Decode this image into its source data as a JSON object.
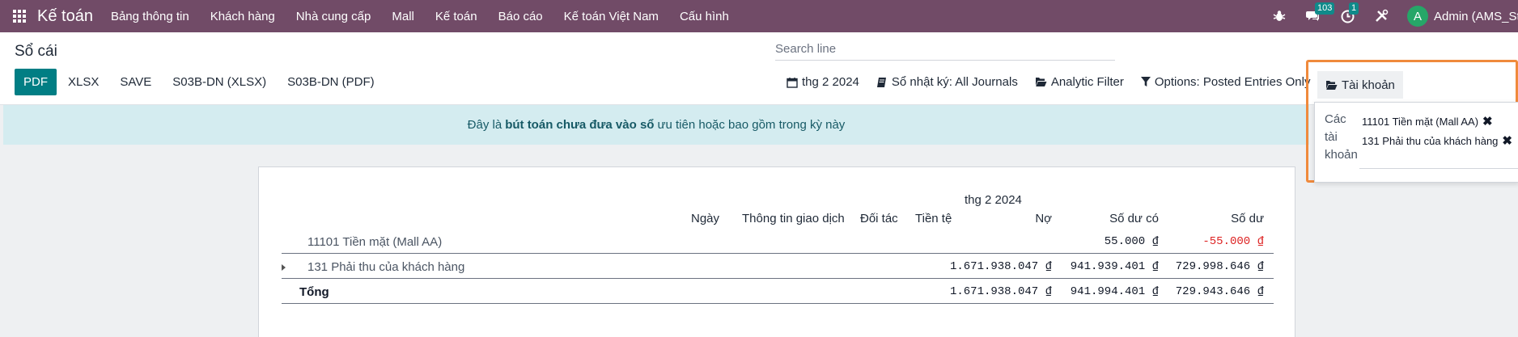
{
  "navbar": {
    "app_name": "Kế toán",
    "menu": [
      "Bảng thông tin",
      "Khách hàng",
      "Nhà cung cấp",
      "Mall",
      "Kế toán",
      "Báo cáo",
      "Kế toán Việt Nam",
      "Cấu hình"
    ],
    "messages_count": "103",
    "activity_count": "1",
    "avatar_letter": "A",
    "user_name": "Admin (AMS_Sta"
  },
  "control": {
    "title": "Sổ cái",
    "search_placeholder": "Search line",
    "buttons": {
      "pdf": "PDF",
      "xlsx": "XLSX",
      "save": "SAVE",
      "s03b_xlsx": "S03B-DN (XLSX)",
      "s03b_pdf": "S03B-DN (PDF)"
    },
    "filters": {
      "date": "thg 2 2024",
      "journal": "Sổ nhật ký: All Journals",
      "analytic": "Analytic Filter",
      "options": "Options: Posted Entries Only",
      "accounts": "Tài khoản"
    }
  },
  "alert": {
    "prefix": "Đây là",
    "bold": "bút toán chưa đưa vào sổ",
    "suffix": "ưu tiên hoặc bao gồm trong kỳ này"
  },
  "accounts_dropdown": {
    "label_lines": [
      "Các",
      "tài",
      "khoản"
    ],
    "tags": [
      "11101 Tiền mặt (Mall AA)",
      "131 Phải thu của khách hàng"
    ]
  },
  "report": {
    "period": "thg 2 2024",
    "headers": {
      "date": "Ngày",
      "info": "Thông tin giao dịch",
      "partner": "Đối tác",
      "currency": "Tiền tệ",
      "debit": "Nợ",
      "credit": "Số dư có",
      "balance": "Số dư"
    },
    "rows": [
      {
        "name": "11101 Tiền mặt (Mall AA)",
        "debit": "",
        "credit": "55.000 ₫",
        "balance": "-55.000 ₫"
      },
      {
        "name": "131 Phải thu của khách hàng",
        "debit": "1.671.938.047 ₫",
        "credit": "941.939.401 ₫",
        "balance": "729.998.646 ₫"
      }
    ],
    "total": {
      "name": "Tổng",
      "debit": "1.671.938.047 ₫",
      "credit": "941.994.401 ₫",
      "balance": "729.943.646 ₫"
    }
  },
  "colors": {
    "navbar": "#714b67",
    "primary": "#017e84",
    "alert_bg": "#d4ecf0",
    "negative": "#dd2222",
    "highlight": "#f08a3c"
  }
}
